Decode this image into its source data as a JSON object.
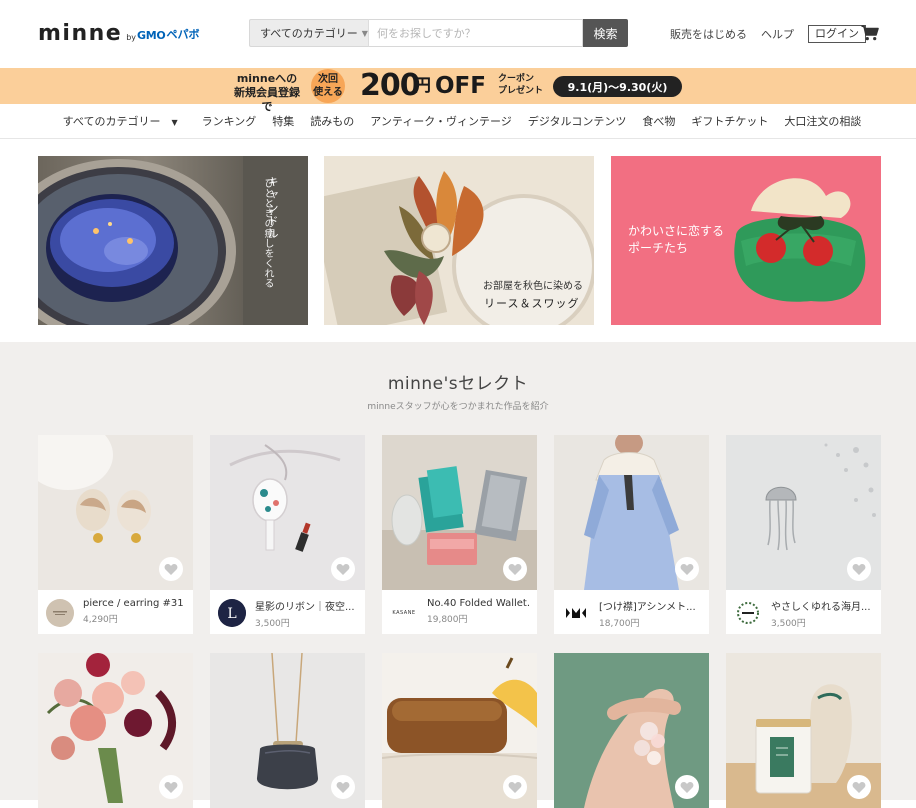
{
  "header": {
    "logo_text": "minne",
    "logo_by": "by",
    "logo_gmo": "GMO",
    "logo_pepabo": "ペパボ",
    "search_category": "すべてのカテゴリー",
    "search_placeholder": "何をお探しですか？",
    "search_button": "検索",
    "sell_link": "販売をはじめる",
    "help_link": "ヘルプ",
    "login_button": "ログイン",
    "cart_icon": "cart-icon"
  },
  "promo": {
    "line1": "minneへの",
    "line2": "新規会員登録で",
    "circle_line1": "次回",
    "circle_line2": "使える",
    "amount": "200",
    "yen": "円",
    "off": "OFF",
    "coupon_line1": "クーポン",
    "coupon_line2": "プレゼント",
    "period": "9.1(月)〜9.30(火)",
    "colors": {
      "bg": "#fbcf9a",
      "circle": "#f7a657",
      "pill": "#222222"
    }
  },
  "catnav": {
    "items": [
      "すべてのカテゴリー",
      "ランキング",
      "特集",
      "読みもの",
      "アンティーク・ヴィンテージ",
      "デジタルコンテンツ",
      "食べ物",
      "ギフトチケット",
      "大口注文の相談"
    ]
  },
  "features": [
    {
      "caption_small": "ひとときの癒しをくれる",
      "caption_main": "キャンドル"
    },
    {
      "caption_small": "お部屋を秋色に染める",
      "caption_main": "リース＆スワッグ"
    },
    {
      "caption_line1": "かわいさに恋する",
      "caption_line2": "ポーチたち"
    }
  ],
  "select": {
    "title": "minne'sセレクト",
    "subtitle": "minneスタッフが心をつかまれた作品を紹介",
    "row1": [
      {
        "name": "pierce / earring #31 ...",
        "price": "4,290円"
      },
      {
        "name": "星影のリボン｜夜空...",
        "price": "3,500円"
      },
      {
        "name": "No.40 Folded Wallet...",
        "price": "19,800円"
      },
      {
        "name": "[つけ襟]アシンメト...",
        "price": "18,700円"
      },
      {
        "name": "やさしくゆれる海月...",
        "price": "3,500円"
      }
    ],
    "avatars": {
      "kasane": "KASANE",
      "mark": "BEADS"
    }
  }
}
